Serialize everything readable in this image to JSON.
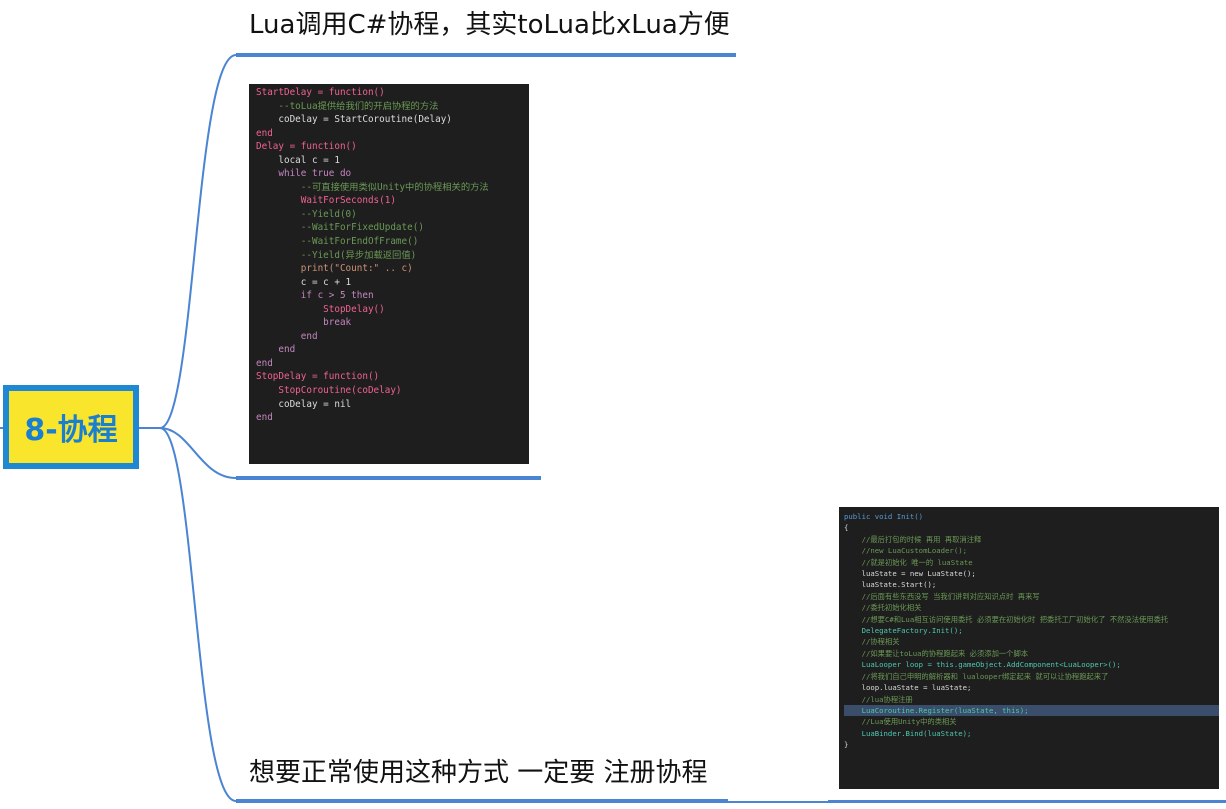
{
  "root": {
    "label": "8-协程"
  },
  "branches": [
    {
      "title": "Lua调用C#协程，其实toLua比xLua方便"
    },
    {
      "title": ""
    },
    {
      "title": "想要正常使用这种方式 一定要 注册协程"
    }
  ],
  "lua_code": {
    "lines": [
      "StartDelay = function()",
      "    --toLua提供给我们的开启协程的方法",
      "    coDelay = StartCoroutine(Delay)",
      "end",
      "",
      "Delay = function()",
      "    local c = 1",
      "    while true do",
      "        --可直接使用类似Unity中的协程相关的方法",
      "        WaitForSeconds(1)",
      "        --Yield(0)",
      "        --WaitForFixedUpdate()",
      "        --WaitForEndOfFrame()",
      "        --Yield(异步加载返回值)",
      "        print(\"Count:\" .. c)",
      "        c = c + 1",
      "",
      "        if c > 5 then",
      "            StopDelay()",
      "            break",
      "        end",
      "    end",
      "end",
      "",
      "StopDelay = function()",
      "    StopCoroutine(coDelay)",
      "    coDelay = nil",
      "end"
    ]
  },
  "cs_code": {
    "lines": [
      "public void Init()",
      "{",
      "    //最后打包的时候 再用 再取消注释",
      "    //new LuaCustomLoader();",
      "    //就是初始化 唯一的 luaState",
      "    luaState = new LuaState();",
      "    luaState.Start();",
      "",
      "    //后面有些东西没写 当我们讲到对应知识点时 再来写",
      "    //委托初始化相关",
      "    //想要C#和Lua相互访问使用委托 必须要在初始化时 把委托工厂初始化了 不然没法使用委托",
      "    DelegateFactory.Init();",
      "    //协程相关",
      "    //如果要让toLua的协程跑起来 必须添加一个脚本",
      "    LuaLooper loop = this.gameObject.AddComponent<LuaLooper>();",
      "    //将我们自己申明的解析器和 lualooper绑定起来 就可以让协程跑起来了",
      "    loop.luaState = luaState;",
      "",
      "    //lua协程注册",
      "    LuaCoroutine.Register(luaState, this);",
      "",
      "    //Lua使用Unity中的类相关",
      "    LuaBinder.Bind(luaState);",
      "}"
    ]
  },
  "colors": {
    "connector": "#4a84d3",
    "root_fill": "#f8e52c",
    "root_border": "#1e88d2",
    "root_text": "#1a7fcf",
    "code_bg": "#1e1e1e"
  }
}
